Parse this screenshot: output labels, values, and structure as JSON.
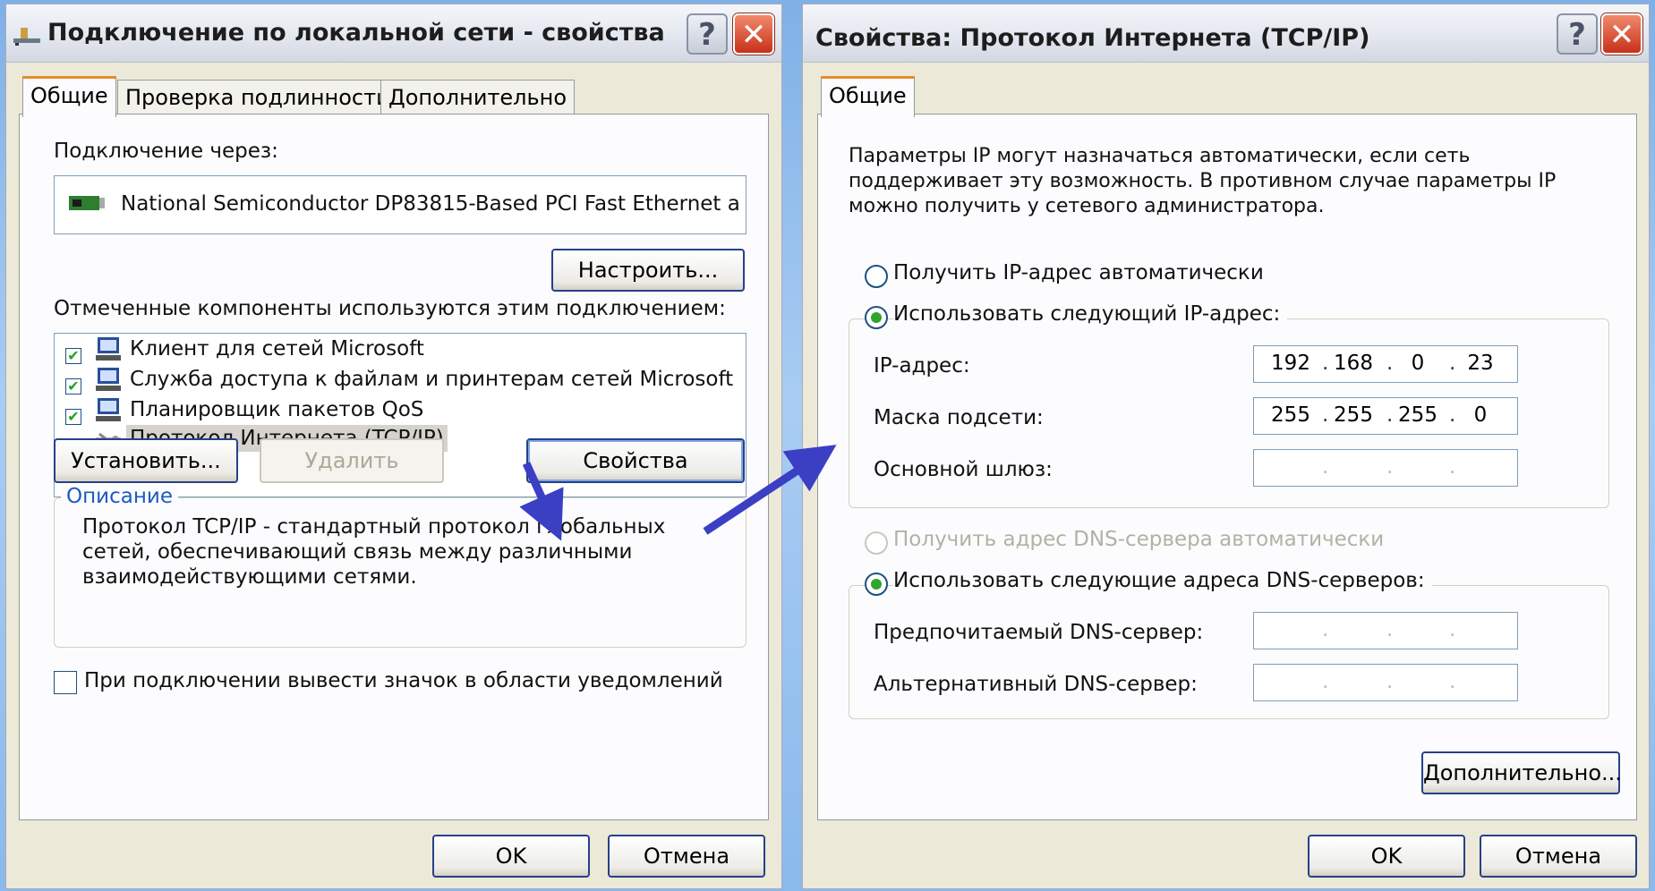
{
  "win1": {
    "title": "Подключение по локальной сети - свойства",
    "tabs": [
      "Общие",
      "Проверка подлинности",
      "Дополнительно"
    ],
    "connect_via_label": "Подключение через:",
    "adapter_name": "National Semiconductor DP83815-Based PCI Fast Ethernet a",
    "configure_button": "Настроить...",
    "components_label": "Отмеченные компоненты используются этим подключением:",
    "components": [
      {
        "label": "Клиент для сетей Microsoft",
        "checked": true
      },
      {
        "label": "Служба доступа к файлам и принтерам сетей Microsoft",
        "checked": true
      },
      {
        "label": "Планировщик пакетов QoS",
        "checked": true
      },
      {
        "label": "Протокол Интернета (TCP/IP)",
        "checked": true,
        "selected": true
      }
    ],
    "install_button": "Установить...",
    "remove_button": "Удалить",
    "properties_button": "Свойства",
    "description_legend": "Описание",
    "description_lines": [
      "Протокол TCP/IP - стандартный протокол глобальных",
      "сетей, обеспечивающий связь между различными",
      "взаимодействующими сетями."
    ],
    "tray_icon_label": "При подключении вывести значок в области уведомлений",
    "ok_button": "OK",
    "cancel_button": "Отмена"
  },
  "win2": {
    "title": "Свойства: Протокол Интернета (TCP/IP)",
    "tab": "Общие",
    "info_lines": [
      "Параметры IP могут назначаться автоматически, если сеть",
      "поддерживает эту возможность. В противном случае параметры IP",
      "можно получить у сетевого администратора."
    ],
    "radio_auto_ip": "Получить IP-адрес автоматически",
    "radio_manual_ip": "Использовать следующий IP-адрес:",
    "ip_label": "IP-адрес:",
    "ip_octets": [
      "192",
      "168",
      "0",
      "23"
    ],
    "mask_label": "Маска подсети:",
    "mask_octets": [
      "255",
      "255",
      "255",
      "0"
    ],
    "gateway_label": "Основной шлюз:",
    "radio_auto_dns": "Получить адрес DNS-сервера автоматически",
    "radio_manual_dns": "Использовать следующие адреса DNS-серверов:",
    "dns_pref_label": "Предпочитаемый DNS-сервер:",
    "dns_alt_label": "Альтернативный DNS-сервер:",
    "advanced_button": "Дополнительно...",
    "ok_button": "OK",
    "cancel_button": "Отмена"
  },
  "colors": {
    "accent_arrow": "#3a3fc4",
    "tab_highlight": "#e68b2c",
    "title_close": "#c8301a"
  }
}
